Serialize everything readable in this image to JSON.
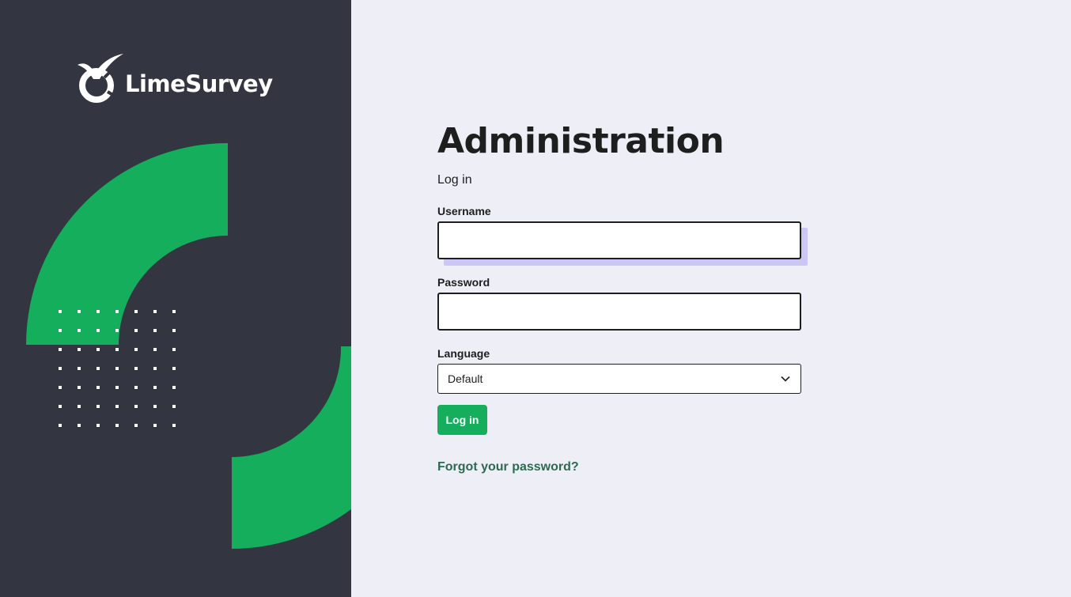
{
  "brand": {
    "name": "LimeSurvey",
    "colors": {
      "green": "#14AE5C",
      "dark": "#333641",
      "background": "#EEEEF7",
      "focus_shadow": "#CBC6F5",
      "link": "#2C6B4F"
    }
  },
  "page": {
    "title": "Administration",
    "subtitle": "Log in"
  },
  "form": {
    "username": {
      "label": "Username",
      "value": "",
      "placeholder": ""
    },
    "password": {
      "label": "Password",
      "value": "",
      "placeholder": ""
    },
    "language": {
      "label": "Language",
      "selected": "Default"
    },
    "submit_label": "Log in",
    "forgot_label": "Forgot your password?"
  },
  "icons": {
    "logo": "limesurvey-logo-icon",
    "dropdown": "chevron-down-icon"
  }
}
